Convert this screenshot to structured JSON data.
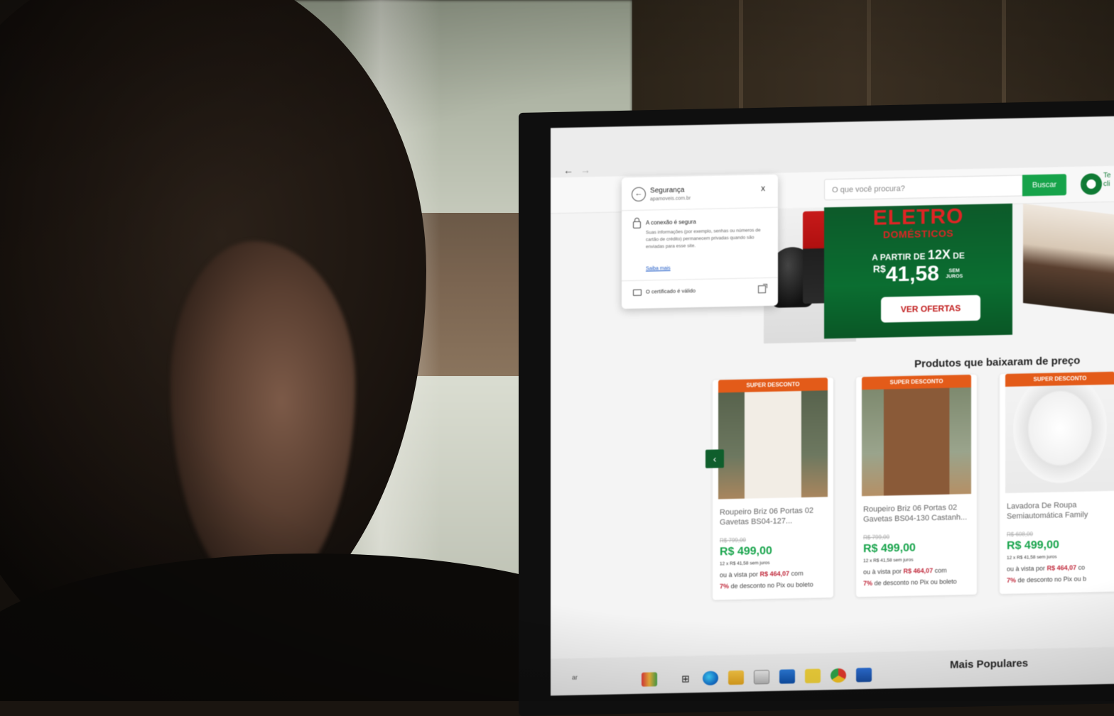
{
  "browser": {
    "back_icon": "arrow-left-icon",
    "forward_icon": "arrow-right-icon"
  },
  "site_header": {
    "search_placeholder": "O que você procura?",
    "search_button": "Buscar",
    "account_text": "Te cli"
  },
  "security_popup": {
    "title": "Segurança",
    "domain": "apamoveis.com.br",
    "close_icon": "x",
    "connection_title": "A conexão é segura",
    "connection_body": "Suas informações (por exemplo, senhas ou números de cartão de crédito) permanecem privadas quando são enviadas para esse site.",
    "learn_more": "Saiba mais",
    "certificate": "O certificado é válido"
  },
  "banner": {
    "title": "ELETRO",
    "subtitle": "DOMÉSTICOS",
    "installments_prefix": "A PARTIR DE",
    "installments_count": "12X",
    "installments_suffix": "DE",
    "currency": "R$",
    "price": "41,58",
    "no_interest": "SEM JUROS",
    "cta": "VER OFERTAS",
    "colors": {
      "green": "#0b6e31",
      "red": "#e02424"
    }
  },
  "products_section": {
    "title": "Produtos que baixaram de preço",
    "items": [
      {
        "badge": "SUPER DESCONTO",
        "name": "Roupeiro Briz 06 Portas 02 Gavetas BS04-127...",
        "old_price": "R$ 799,00",
        "price": "R$ 499,00",
        "installments": "12 x R$ 41,58 sem juros",
        "pix_prefix": "ou à vista por",
        "pix_price": "R$ 464,07",
        "pix_suffix": "com",
        "discount_pct": "7%",
        "discount_text": "de desconto no Pix ou boleto"
      },
      {
        "badge": "SUPER DESCONTO",
        "name": "Roupeiro Briz 06 Portas 02 Gavetas BS04-130 Castanh...",
        "old_price": "R$ 799,00",
        "price": "R$ 499,00",
        "installments": "12 x R$ 41,58 sem juros",
        "pix_prefix": "ou à vista por",
        "pix_price": "R$ 464,07",
        "pix_suffix": "com",
        "discount_pct": "7%",
        "discount_text": "de desconto no Pix ou boleto"
      },
      {
        "badge": "SUPER DESCONTO",
        "name": "Lavadora De Roupa Semiautomática Family",
        "old_price": "R$ 608,00",
        "price": "R$ 499,00",
        "installments": "12 x R$ 41,58 sem juros",
        "pix_prefix": "ou à vista por",
        "pix_price": "R$ 464,07",
        "pix_suffix": "co",
        "discount_pct": "7%",
        "discount_text": "de desconto no Pix ou b"
      }
    ],
    "carousel_prev": "‹"
  },
  "most_popular": {
    "title": "Mais Populares"
  },
  "taskbar": {
    "search_text": "ar",
    "apps": [
      "gift-icon",
      "task-view-icon",
      "edge-icon",
      "file-explorer-icon",
      "store-icon",
      "mail-icon",
      "sticky-notes-icon",
      "chrome-icon",
      "word-icon"
    ]
  }
}
